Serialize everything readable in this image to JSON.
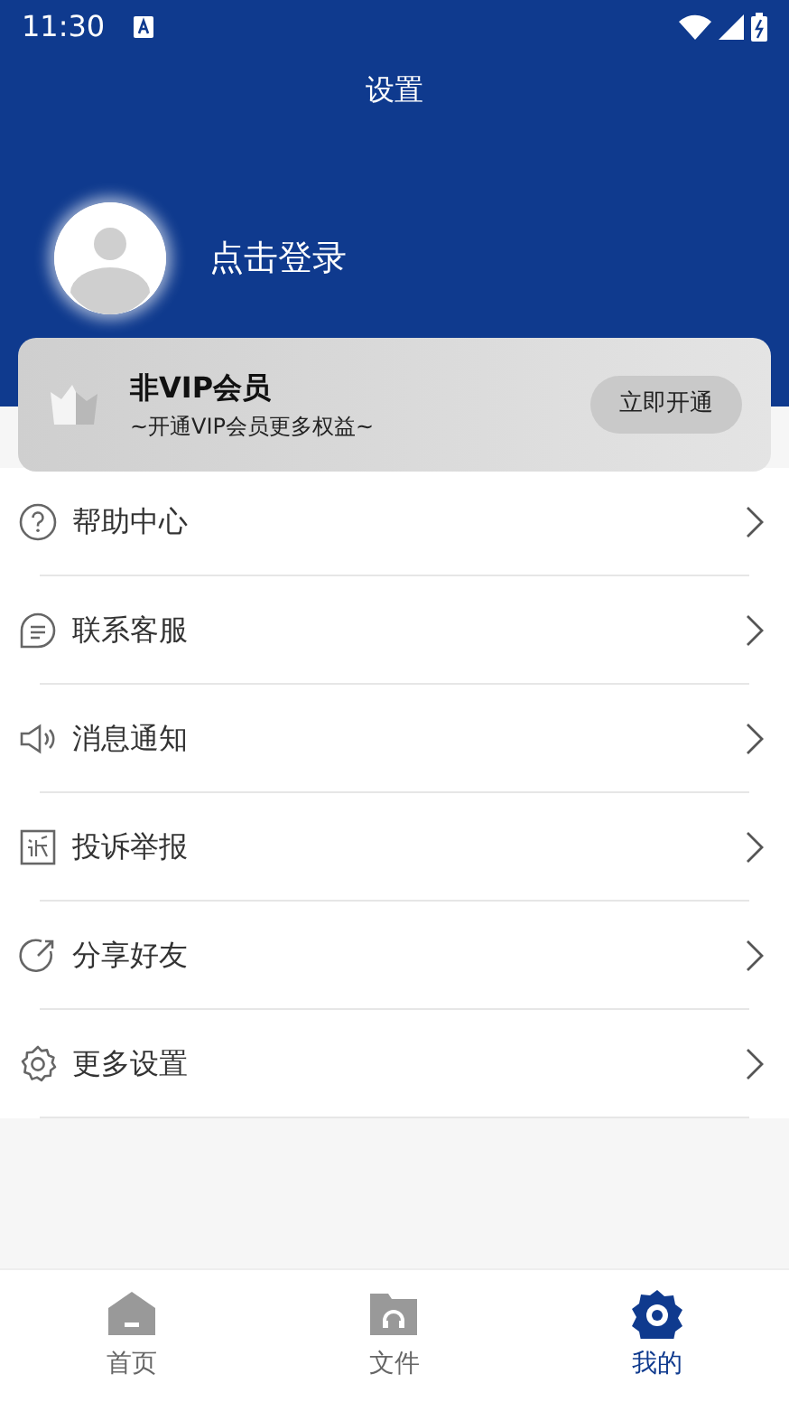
{
  "status_bar": {
    "time": "11:30"
  },
  "header": {
    "title": "设置",
    "login_label": "点击登录"
  },
  "vip_card": {
    "title": "非VIP会员",
    "subtitle": "~开通VIP会员更多权益~",
    "button": "立即开通"
  },
  "menu": [
    {
      "label": "帮助中心"
    },
    {
      "label": "联系客服"
    },
    {
      "label": "消息通知"
    },
    {
      "label": "投诉举报"
    },
    {
      "label": "分享好友"
    },
    {
      "label": "更多设置"
    }
  ],
  "tabs": [
    {
      "label": "首页",
      "selected": false
    },
    {
      "label": "文件",
      "selected": false
    },
    {
      "label": "我的",
      "selected": true
    }
  ]
}
